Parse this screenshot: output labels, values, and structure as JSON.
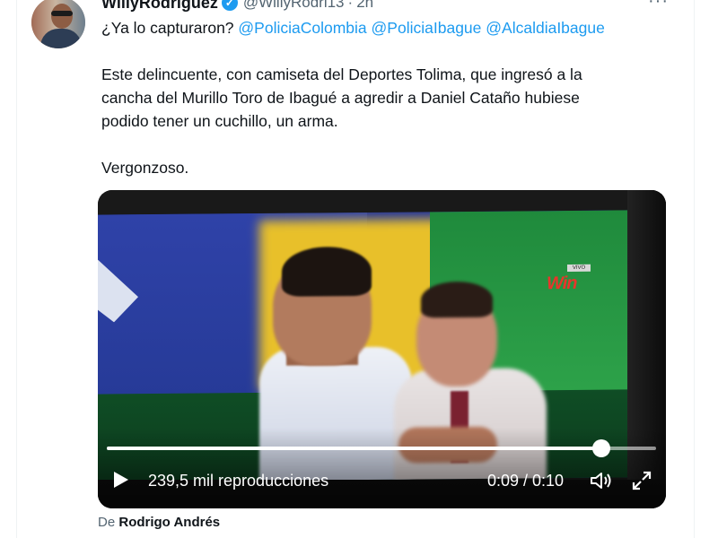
{
  "tweet": {
    "author_name": "WillyRodriguez",
    "handle": "@WillyRodri13",
    "separator": "·",
    "time": "2h",
    "more": "···",
    "reply_prefix": "¿Ya lo capturaron?",
    "mentions": [
      "@PoliciaColombia",
      "@PoliciaIbague",
      "@AlcaldiaIbague"
    ],
    "body_lines": [
      "Este delincuente, con camiseta del Deportes Tolima, que ingresó a la",
      "cancha del Murillo Toro de Ibagué a agredir a Daniel Cataño hubiese",
      "podido tener un cuchillo, un arma."
    ],
    "body_closing": "Vergonzoso."
  },
  "video": {
    "views": "239,5 mil reproducciones",
    "time_readout": "0:09 / 0:10",
    "progress_fraction": 0.9,
    "broadcaster_badge": "VIVO",
    "broadcaster_logo": "Win",
    "icons": {
      "play": "play-icon",
      "volume": "volume-icon",
      "fullscreen": "fullscreen-icon"
    }
  },
  "source": {
    "prefix": "De",
    "name": "Rodrigo Andrés"
  },
  "colors": {
    "link": "#1d9bf0",
    "text": "#0f1419",
    "secondary": "#536471"
  }
}
